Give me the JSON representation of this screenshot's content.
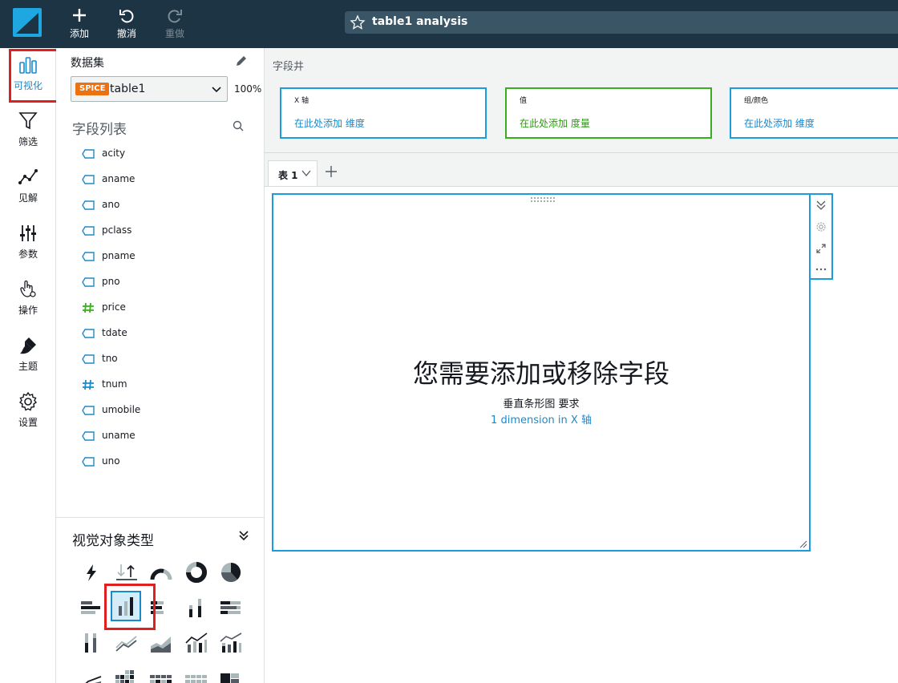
{
  "toolbar": {
    "add_label": "添加",
    "undo_label": "撤消",
    "redo_label": "重做",
    "analysis_title": "table1 analysis"
  },
  "leftnav": {
    "items": [
      {
        "label": "可视化",
        "icon": "bar-chart-icon",
        "active": true
      },
      {
        "label": "筛选",
        "icon": "filter-icon"
      },
      {
        "label": "见解",
        "icon": "insights-icon"
      },
      {
        "label": "参数",
        "icon": "sliders-icon"
      },
      {
        "label": "操作",
        "icon": "hand-pointer-icon"
      },
      {
        "label": "主题",
        "icon": "brush-icon"
      },
      {
        "label": "设置",
        "icon": "gear-icon"
      }
    ]
  },
  "dataset": {
    "title": "数据集",
    "badge": "SPICE",
    "name": "table1",
    "spice_usage": "100%",
    "field_list_title": "字段列表",
    "fields": [
      {
        "name": "acity",
        "type": "dimension"
      },
      {
        "name": "aname",
        "type": "dimension"
      },
      {
        "name": "ano",
        "type": "dimension"
      },
      {
        "name": "pclass",
        "type": "dimension"
      },
      {
        "name": "pname",
        "type": "dimension"
      },
      {
        "name": "pno",
        "type": "dimension"
      },
      {
        "name": "price",
        "type": "measure"
      },
      {
        "name": "tdate",
        "type": "dimension"
      },
      {
        "name": "tno",
        "type": "dimension"
      },
      {
        "name": "tnum",
        "type": "measure"
      },
      {
        "name": "umobile",
        "type": "dimension"
      },
      {
        "name": "uname",
        "type": "dimension"
      },
      {
        "name": "uno",
        "type": "dimension"
      }
    ]
  },
  "visual_types": {
    "title": "视觉对象类型",
    "selected": "vertical-bar-chart"
  },
  "field_wells": {
    "title": "字段井",
    "wells": [
      {
        "label": "X 轴",
        "hint": "在此处添加 维度"
      },
      {
        "label": "值",
        "hint": "在此处添加 度量"
      },
      {
        "label": "组/颜色",
        "hint": "在此处添加 维度"
      }
    ]
  },
  "sheet": {
    "tab_label": "表 1"
  },
  "visual": {
    "message": "您需要添加或移除字段",
    "requirement_title": "垂直条形图 要求",
    "requirement_detail": "1 dimension in X 轴"
  },
  "colors": {
    "topbar": "#1d3444",
    "accent": "#1a8acd",
    "measure_green": "#3aae1f",
    "highlight_red": "#e02020"
  }
}
